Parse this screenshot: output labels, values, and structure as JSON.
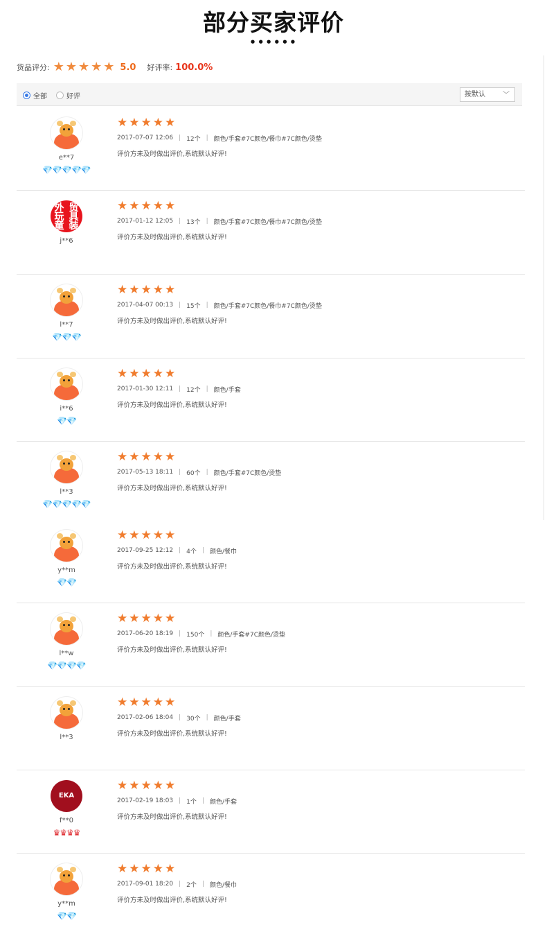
{
  "header": {
    "title": "部分买家评价",
    "dots": "••••••"
  },
  "summary": {
    "label": "货品评分:",
    "score": "5.0",
    "rate_label": "好评率:",
    "rate": "100.0%",
    "stars": 5
  },
  "filters": {
    "all_label": "全部",
    "good_label": "好评",
    "sort_label": "按默认"
  },
  "reviews": [
    {
      "user": "e**7",
      "avatar": "bull-icon",
      "badges": "💎💎💎💎💎",
      "badge_type": "diamond",
      "date": "2017-07-07 12:06",
      "qty": "12个",
      "spec": "颜色/手套#7C颜色/餐巾#7C颜色/烫垫",
      "text": "评价方未及时做出评价,系统默认好评!"
    },
    {
      "user": "j**6",
      "avatar": "red-logo",
      "badges": "",
      "badge_type": "diamond",
      "date": "2017-01-12 12:05",
      "qty": "13个",
      "spec": "颜色/手套#7C颜色/餐巾#7C颜色/烫垫",
      "text": "评价方未及时做出评价,系统默认好评!"
    },
    {
      "user": "l**7",
      "avatar": "bull-icon",
      "badges": "💎💎💎",
      "badge_type": "diamond",
      "date": "2017-04-07 00:13",
      "qty": "15个",
      "spec": "颜色/手套#7C颜色/餐巾#7C颜色/烫垫",
      "text": "评价方未及时做出评价,系统默认好评!"
    },
    {
      "user": "i**6",
      "avatar": "bull-icon",
      "badges": "💎💎",
      "badge_type": "diamond",
      "date": "2017-01-30 12:11",
      "qty": "12个",
      "spec": "颜色/手套",
      "text": "评价方未及时做出评价,系统默认好评!"
    },
    {
      "user": "l**3",
      "avatar": "bull-icon",
      "badges": "💎💎💎💎💎",
      "badge_type": "diamond",
      "date": "2017-05-13 18:11",
      "qty": "60个",
      "spec": "颜色/手套#7C颜色/烫垫",
      "text": "评价方未及时做出评价,系统默认好评!"
    },
    {
      "user": "y**m",
      "avatar": "bull-icon",
      "badges": "💎💎",
      "badge_type": "diamond",
      "date": "2017-09-25 12:12",
      "qty": "4个",
      "spec": "颜色/餐巾",
      "text": "评价方未及时做出评价,系统默认好评!"
    },
    {
      "user": "l**w",
      "avatar": "bull-icon",
      "badges": "💎💎💎💎",
      "badge_type": "diamond",
      "date": "2017-06-20 18:19",
      "qty": "150个",
      "spec": "颜色/手套#7C颜色/烫垫",
      "text": "评价方未及时做出评价,系统默认好评!"
    },
    {
      "user": "l**3",
      "avatar": "bull-icon",
      "badges": "",
      "badge_type": "diamond",
      "date": "2017-02-06 18:04",
      "qty": "30个",
      "spec": "颜色/手套",
      "text": "评价方未及时做出评价,系统默认好评!"
    },
    {
      "user": "f**0",
      "avatar": "eka-logo",
      "badges": "♛♛♛♛",
      "badge_type": "crown",
      "date": "2017-02-19 18:03",
      "qty": "1个",
      "spec": "颜色/手套",
      "text": "评价方未及时做出评价,系统默认好评!"
    },
    {
      "user": "y**m",
      "avatar": "bull-icon",
      "badges": "💎💎",
      "badge_type": "diamond",
      "date": "2017-09-01 18:20",
      "qty": "2个",
      "spec": "颜色/餐巾",
      "text": "评价方未及时做出评价,系统默认好评!"
    }
  ],
  "logos": {
    "red_logo_chars": [
      "外",
      "贸",
      "玩",
      "具",
      "童",
      "装"
    ],
    "eka_text": "EKA"
  }
}
